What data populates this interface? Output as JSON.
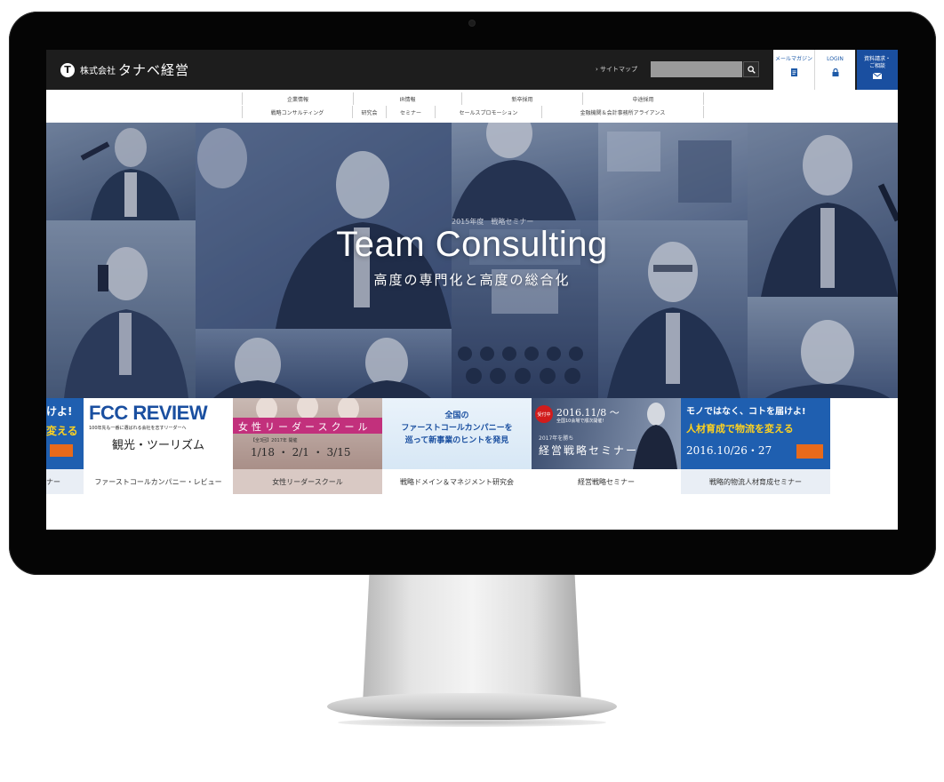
{
  "header": {
    "logo_kabushiki": "株式会社",
    "logo_name": "タナベ経営",
    "sitemap_label": "› サイトマップ",
    "search_placeholder": "",
    "mail_magazine_label": "メールマガジン",
    "login_label": "LOGIN",
    "request_label_line1": "資料請求・",
    "request_label_line2": "ご相談"
  },
  "nav": {
    "row1": [
      "企業情報",
      "IR情報",
      "新卒採用",
      "中途採用"
    ],
    "row2": [
      "戦略コンサルティング",
      "研究会",
      "セミナー",
      "セールスプロモーション",
      "金融機関＆会計事務所アライアンス"
    ]
  },
  "hero": {
    "title": "Team Consulting",
    "subtitle": "高度の専門化と高度の総合化",
    "seminar_sign": "2015年度　戦略セミナー"
  },
  "banners": [
    {
      "headline_top": "けよ!",
      "headline_bottom": "変える",
      "caption": "ナー"
    },
    {
      "headline": "FCC REVIEW",
      "tagline": "100年先も一番に選ばれる会社を志すリーダーへ",
      "topic": "観光・ツーリズム",
      "caption": "ファーストコールカンパニー・レビュー"
    },
    {
      "headline": "女性リーダースクール",
      "dates": "1/18 ・ 2/1 ・ 3/15",
      "sub": "【全3回】2017年 開催",
      "caption": "女性リーダースクール"
    },
    {
      "line1": "全国の",
      "line2": "ファーストコールカンパニーを",
      "line3": "巡って新事業のヒントを発見",
      "caption": "戦略ドメイン＆マネジメント研究会"
    },
    {
      "badge": "受付中",
      "date": "2016.11/8 ～",
      "venue": "全国10会場で順次開催!",
      "headline": "経営戦略セミナー",
      "subline": "2017年を勝ち",
      "caption": "経営戦略セミナー"
    },
    {
      "line1": "モノではなく、コトを届けよ!",
      "line2": "人材育成で物流を変える",
      "date": "2016.10/26・27",
      "caption": "戦略的物流人材育成セミナー"
    }
  ],
  "colors": {
    "header_bg": "#1d1d1d",
    "accent_blue": "#1a4fa0",
    "hero_tint": "#4d6080"
  },
  "icons": {
    "search": "search-icon",
    "mail_magazine": "document-icon",
    "login": "lock-icon",
    "request": "envelope-icon"
  }
}
